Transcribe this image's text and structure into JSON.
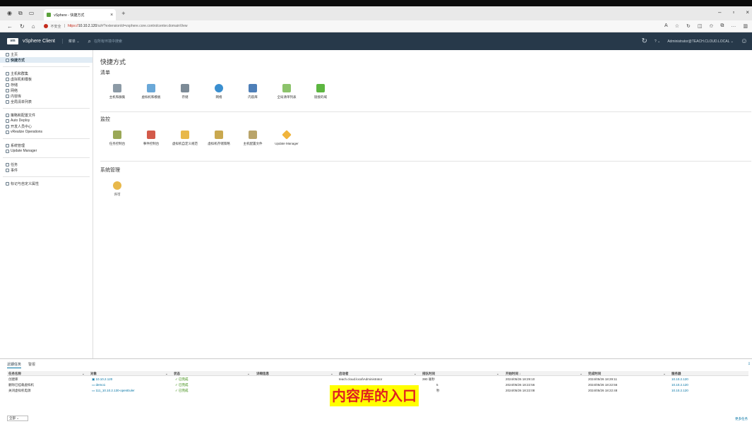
{
  "browser": {
    "tab_title": "vSphere - 快捷方式",
    "url_warning": "不安全",
    "url_https": "https://",
    "url_host": "10.10.2.120",
    "url_path": "/ui/#?extensionId=vsphere.core.controlcenter.domainView"
  },
  "header": {
    "app_name": "vSphere Client",
    "menu_label": "菜单",
    "search_placeholder": "在所有环境中搜索",
    "user": "Administrator@TEACH.CLOUD.LOCAL"
  },
  "sidebar": {
    "group1": [
      {
        "label": "主页"
      },
      {
        "label": "快捷方式"
      }
    ],
    "group2": [
      {
        "label": "主机和群集"
      },
      {
        "label": "虚拟机和模板"
      },
      {
        "label": "存储"
      },
      {
        "label": "网络"
      },
      {
        "label": "内容库"
      },
      {
        "label": "全局清单列表"
      }
    ],
    "group3": [
      {
        "label": "策略和配置文件"
      },
      {
        "label": "Auto Deploy"
      },
      {
        "label": "开发人员中心"
      },
      {
        "label": "vRealize Operations"
      }
    ],
    "group4": [
      {
        "label": "系统管理"
      },
      {
        "label": "Update Manager"
      }
    ],
    "group5": [
      {
        "label": "任务"
      },
      {
        "label": "事件"
      }
    ],
    "group6": [
      {
        "label": "标记与自定义属性"
      }
    ]
  },
  "main": {
    "title": "快捷方式",
    "inventory": {
      "title": "清单",
      "tiles": [
        {
          "label": "主机和群集"
        },
        {
          "label": "虚拟机和模板"
        },
        {
          "label": "存储"
        },
        {
          "label": "网络"
        },
        {
          "label": "内容库"
        },
        {
          "label": "全局清单列表"
        },
        {
          "label": "链接的域"
        }
      ]
    },
    "monitor": {
      "title": "监控",
      "tiles": [
        {
          "label": "任务控制台"
        },
        {
          "label": "事件控制台"
        },
        {
          "label": "虚拟机自定义规范"
        },
        {
          "label": "虚拟机存储策略"
        },
        {
          "label": "主机配置文件"
        },
        {
          "label": "Update Manager"
        }
      ]
    },
    "admin": {
      "title": "系统管理",
      "tiles": [
        {
          "label": "许可"
        }
      ]
    }
  },
  "tasks": {
    "tab_recent": "近期任务",
    "tab_alarms": "警报",
    "columns": [
      "任务名称",
      "对象",
      "状态",
      "详细信息",
      "启动者",
      "排队时间",
      "开始时间 ↓",
      "完成时间",
      "服务器"
    ],
    "rows": [
      {
        "name": "创建库",
        "object": "10.10.2.120",
        "status": "已完成",
        "initiator": "teach.cloud.local\\Administrator",
        "queued": "390 毫秒",
        "start": "2024/05/26 18:29:10",
        "end": "2024/05/26 18:29:11",
        "server": "10.10.2.120"
      },
      {
        "name": "删除已挂载虚拟机",
        "object": "demo1",
        "status": "已完成",
        "initiator": "",
        "queued": "5",
        "start": "2024/05/26 18:22:56",
        "end": "2024/05/26 18:22:56",
        "server": "10.10.2.120"
      },
      {
        "name": "关闭虚拟机电源",
        "object": "111_10.10.2.130-openEuler",
        "status": "已完成",
        "initiator": "",
        "queued": "秒",
        "start": "2024/05/26 18:22:08",
        "end": "2024/05/26 18:22:48",
        "server": "10.10.2.120"
      }
    ],
    "filter": "全部",
    "more": "更多任务"
  },
  "annotation": "内容库的入口",
  "colors": {
    "header_bg": "#27394a",
    "link": "#0072a3",
    "annotation_bg": "#ffff00",
    "annotation_text": "#e02020"
  }
}
